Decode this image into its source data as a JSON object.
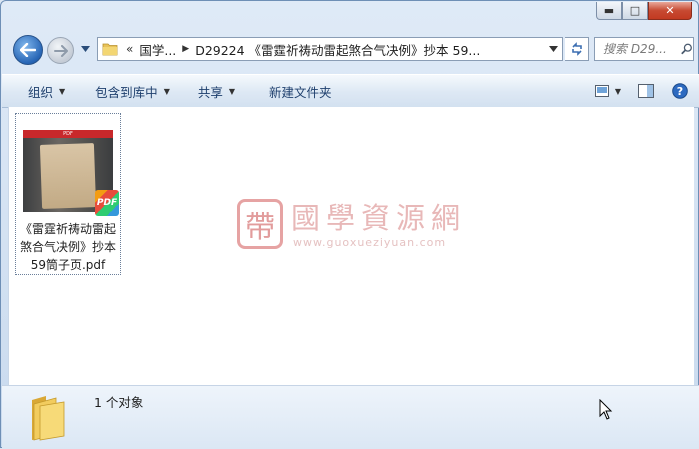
{
  "window": {
    "caption_buttons": {
      "minimize": "▬",
      "maximize": "□",
      "close": "✕"
    }
  },
  "nav": {
    "address": {
      "overflow": "«",
      "segments": [
        "国学...",
        "D29224 《雷霆祈祷动雷起煞合气决例》抄本 59..."
      ]
    },
    "search_placeholder": "搜索 D29..."
  },
  "toolbar": {
    "items": [
      {
        "label": "组织",
        "has_caret": true
      },
      {
        "label": "包含到库中",
        "has_caret": true
      },
      {
        "label": "共享",
        "has_caret": true
      },
      {
        "label": "新建文件夹",
        "has_caret": false
      }
    ]
  },
  "content": {
    "files": [
      {
        "name": "《雷霆祈祷动雷起煞合气决例》抄本59筒子页.pdf",
        "thumb_label": "PDF",
        "badge": "PDF"
      }
    ],
    "watermark": {
      "title": "國學資源網",
      "url": "www.guoxueziyuan.com",
      "seal_glyph": "帶"
    }
  },
  "status": {
    "text": "1 个对象"
  },
  "colors": {
    "accent": "#2765b5",
    "toolbar_text": "#1e3f6d",
    "close": "#c74a32"
  }
}
